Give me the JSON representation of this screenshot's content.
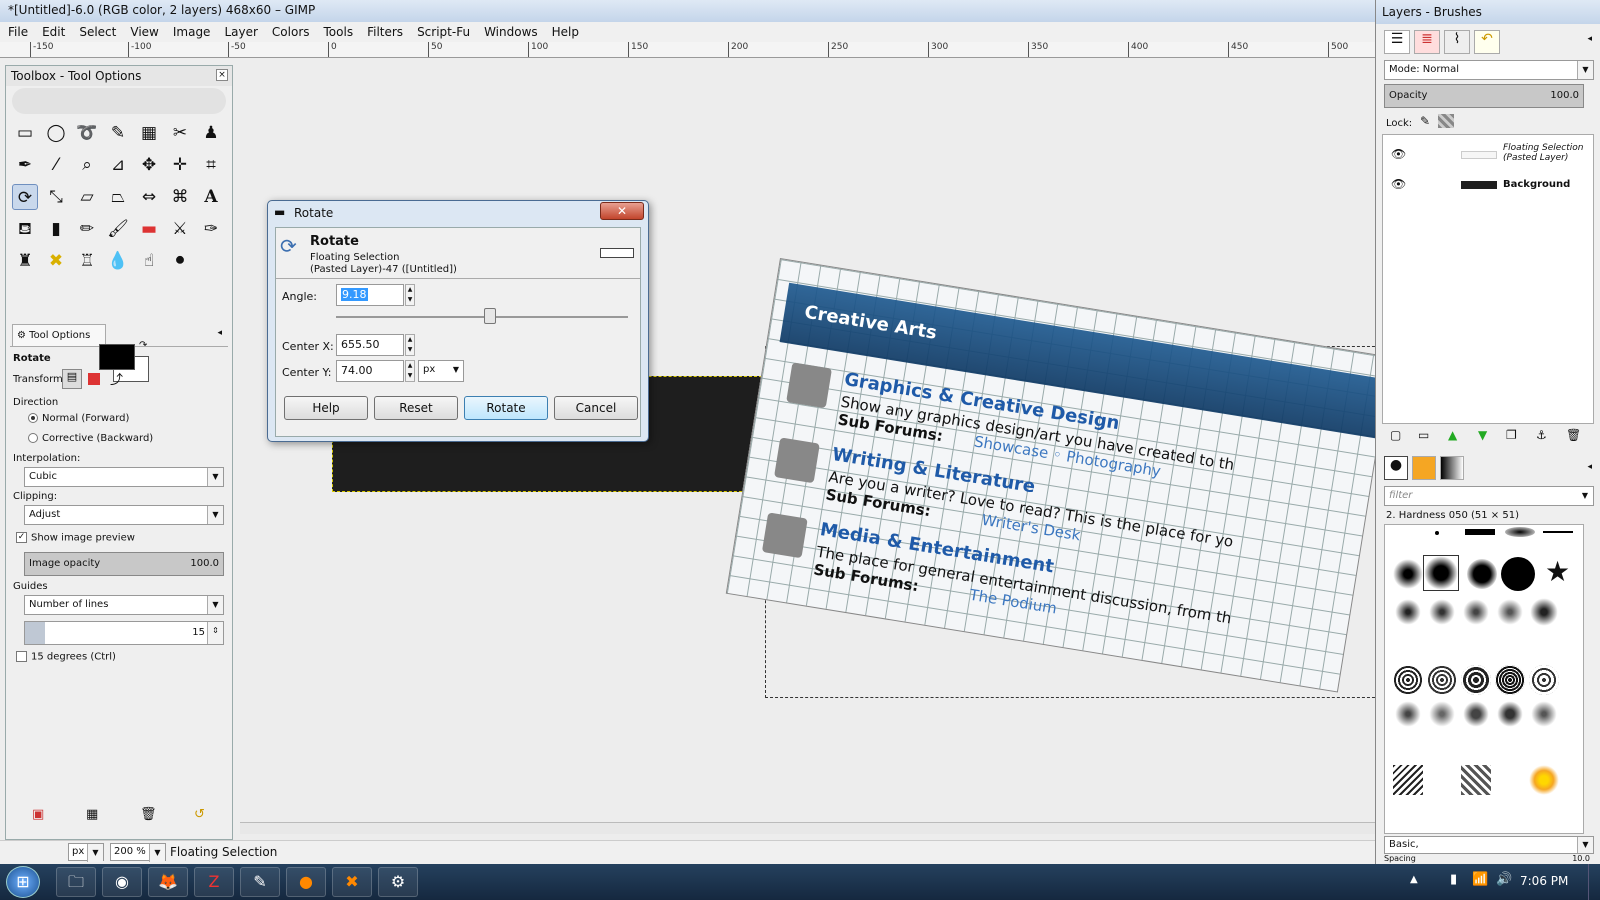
{
  "window": {
    "title": "*[Untitled]-6.0 (RGB color, 2 layers) 468x60 – GIMP"
  },
  "menu": [
    "File",
    "Edit",
    "Select",
    "View",
    "Image",
    "Layer",
    "Colors",
    "Tools",
    "Filters",
    "Script-Fu",
    "Windows",
    "Help"
  ],
  "ruler_labels": [
    "-150",
    "-100",
    "-50",
    "0",
    "50",
    "100",
    "150",
    "200",
    "250",
    "300",
    "350",
    "400",
    "450",
    "500"
  ],
  "toolbox": {
    "title": "Toolbox - Tool Options",
    "tool_options_tab": "Tool Options",
    "tool_name": "Rotate",
    "transform_label": "Transform:",
    "direction_label": "Direction",
    "direction_normal": "Normal (Forward)",
    "direction_corrective": "Corrective (Backward)",
    "interpolation_label": "Interpolation:",
    "interpolation_value": "Cubic",
    "clipping_label": "Clipping:",
    "clipping_value": "Adjust",
    "show_preview": "Show image preview",
    "image_opacity_label": "Image opacity",
    "image_opacity_value": "100.0",
    "guides_label": "Guides",
    "guides_value": "Number of lines",
    "guides_count": "15",
    "fifteen_deg": "15 degrees  (Ctrl)"
  },
  "canvas": {
    "banner_title": "Creative Arts",
    "forums": [
      {
        "title": "Graphics & Creative Design",
        "desc": "Show any graphics design/art you have created to th",
        "sub_label": "Sub Forums:",
        "subs": "Showcase   ◦ Photography"
      },
      {
        "title": "Writing & Literature",
        "desc": "Are you a writer? Love to read? This is the place for yo",
        "sub_label": "Sub Forums:",
        "subs": "Writer's Desk"
      },
      {
        "title": "Media & Entertainment",
        "desc": "The place for general entertainment discussion, from th",
        "sub_label": "Sub Forums:",
        "subs": "The Podium"
      }
    ]
  },
  "status": {
    "unit": "px",
    "zoom": "200 %",
    "message": "Floating Selection"
  },
  "dialog": {
    "title": "Rotate",
    "heading": "Rotate",
    "sub1": "Floating Selection",
    "sub2": "(Pasted Layer)-47 ([Untitled])",
    "angle_label": "Angle:",
    "angle_value": "9.18",
    "cx_label": "Center X:",
    "cx_value": "655.50",
    "cy_label": "Center Y:",
    "cy_value": "74.00",
    "unit": "px",
    "help": "Help",
    "reset": "Reset",
    "rotate": "Rotate",
    "cancel": "Cancel"
  },
  "layers": {
    "title": "Layers - Brushes",
    "mode_label": "Mode: Normal",
    "opacity_label": "Opacity",
    "opacity_value": "100.0",
    "lock_label": "Lock:",
    "items": [
      {
        "name": "Floating Selection (Pasted Layer)"
      },
      {
        "name": "Background"
      }
    ]
  },
  "brushes": {
    "filter_placeholder": "filter",
    "selected": "2. Hardness 050 (51 × 51)",
    "preset": "Basic,",
    "spacing_label": "Spacing",
    "spacing_value": "10.0"
  },
  "taskbar": {
    "time": "7:06 PM"
  }
}
